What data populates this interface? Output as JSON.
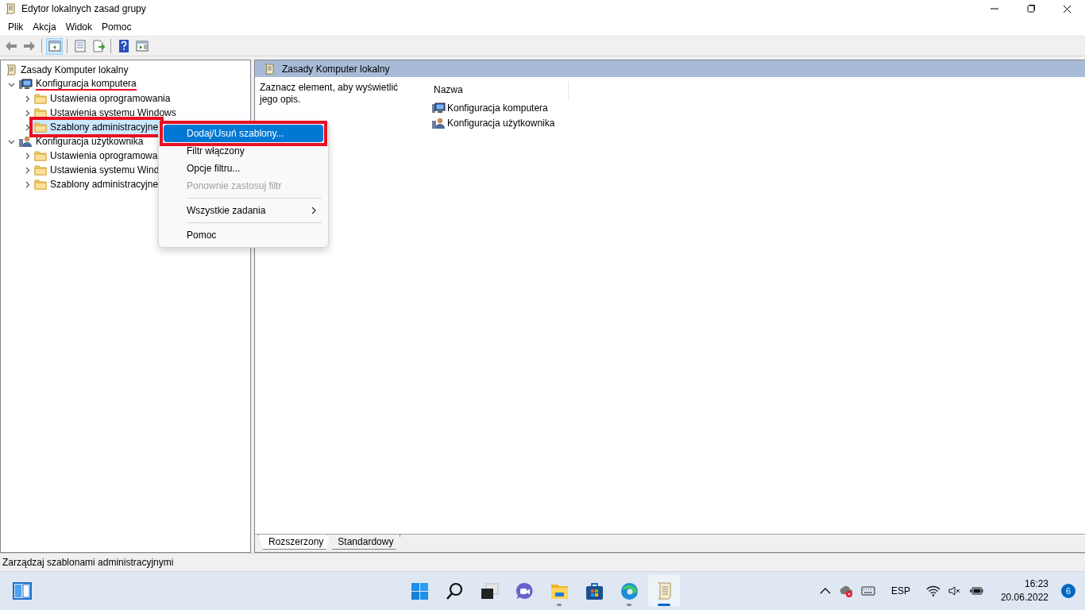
{
  "window": {
    "title": "Edytor lokalnych zasad grupy"
  },
  "menu_bar": [
    "Plik",
    "Akcja",
    "Widok",
    "Pomoc"
  ],
  "toolbar": [
    {
      "kind": "back",
      "selected": false
    },
    {
      "kind": "forward",
      "selected": false
    },
    {
      "kind": "separator"
    },
    {
      "kind": "tree-toggle",
      "selected": true
    },
    {
      "kind": "separator"
    },
    {
      "kind": "properties",
      "selected": false
    },
    {
      "kind": "export",
      "selected": false
    },
    {
      "kind": "separator"
    },
    {
      "kind": "help",
      "selected": false
    },
    {
      "kind": "pane-toggle",
      "selected": false
    }
  ],
  "tree": {
    "label": "Zasady Komputer lokalny",
    "kind": "policy",
    "children": [
      {
        "label": "Konfiguracja komputera",
        "kind": "computer",
        "expanded": true,
        "selected": false,
        "red_underline": true,
        "children": [
          {
            "label": "Ustawienia oprogramowania",
            "kind": "folder",
            "expanded": false,
            "selected": false
          },
          {
            "label": "Ustawienia systemu Windows",
            "kind": "folder",
            "expanded": false,
            "selected": false
          },
          {
            "label": "Szablony administracyjne",
            "kind": "folder",
            "expanded": false,
            "selected": true,
            "red_box": true
          }
        ]
      },
      {
        "label": "Konfiguracja użytkownika",
        "kind": "user",
        "expanded": true,
        "selected": false,
        "children": [
          {
            "label": "Ustawienia oprogramowa",
            "kind": "folder",
            "expanded": false,
            "selected": false
          },
          {
            "label": "Ustawienia systemu Wind",
            "kind": "folder",
            "expanded": false,
            "selected": false
          },
          {
            "label": "Szablony administracyjne",
            "kind": "folder",
            "expanded": false,
            "selected": false
          }
        ]
      }
    ]
  },
  "context_menu": [
    {
      "kind": "item",
      "label": "Dodaj/Usuń szablony...",
      "selected": true,
      "disabled": false,
      "submenu": false,
      "red_box": true
    },
    {
      "kind": "item",
      "label": "Filtr włączony",
      "selected": false,
      "disabled": false,
      "submenu": false
    },
    {
      "kind": "item",
      "label": "Opcje filtru...",
      "selected": false,
      "disabled": false,
      "submenu": false
    },
    {
      "kind": "item",
      "label": "Ponownie zastosuj filtr",
      "selected": false,
      "disabled": true,
      "submenu": false
    },
    {
      "kind": "separator"
    },
    {
      "kind": "item",
      "label": "Wszystkie zadania",
      "selected": false,
      "disabled": false,
      "submenu": true
    },
    {
      "kind": "separator"
    },
    {
      "kind": "item",
      "label": "Pomoc",
      "selected": false,
      "disabled": false,
      "submenu": false
    }
  ],
  "detail_pane": {
    "header": "Zasady Komputer lokalny",
    "description": "Zaznacz element, aby wyświetlić jego opis.",
    "columns": [
      "Nazwa"
    ],
    "items": [
      {
        "label": "Konfiguracja komputera",
        "kind": "computer"
      },
      {
        "label": "Konfiguracja użytkownika",
        "kind": "user"
      }
    ],
    "tabs": [
      {
        "label": "Rozszerzony",
        "selected": true
      },
      {
        "label": "Standardowy",
        "selected": false
      }
    ]
  },
  "status_bar": "Zarządzaj szablonami administracyjnymi",
  "taskbar": {
    "apps": [
      {
        "kind": "start",
        "running": false,
        "active": false
      },
      {
        "kind": "search",
        "running": false,
        "active": false
      },
      {
        "kind": "task-view",
        "running": false,
        "active": false
      },
      {
        "kind": "chat",
        "running": false,
        "active": false
      },
      {
        "kind": "explorer",
        "running": true,
        "active": false
      },
      {
        "kind": "store",
        "running": false,
        "active": false
      },
      {
        "kind": "edge",
        "running": true,
        "active": false
      },
      {
        "kind": "policy",
        "running": true,
        "active": true
      }
    ],
    "language": "ESP",
    "time": "16:23",
    "date": "20.06.2022",
    "notifications": "6"
  }
}
